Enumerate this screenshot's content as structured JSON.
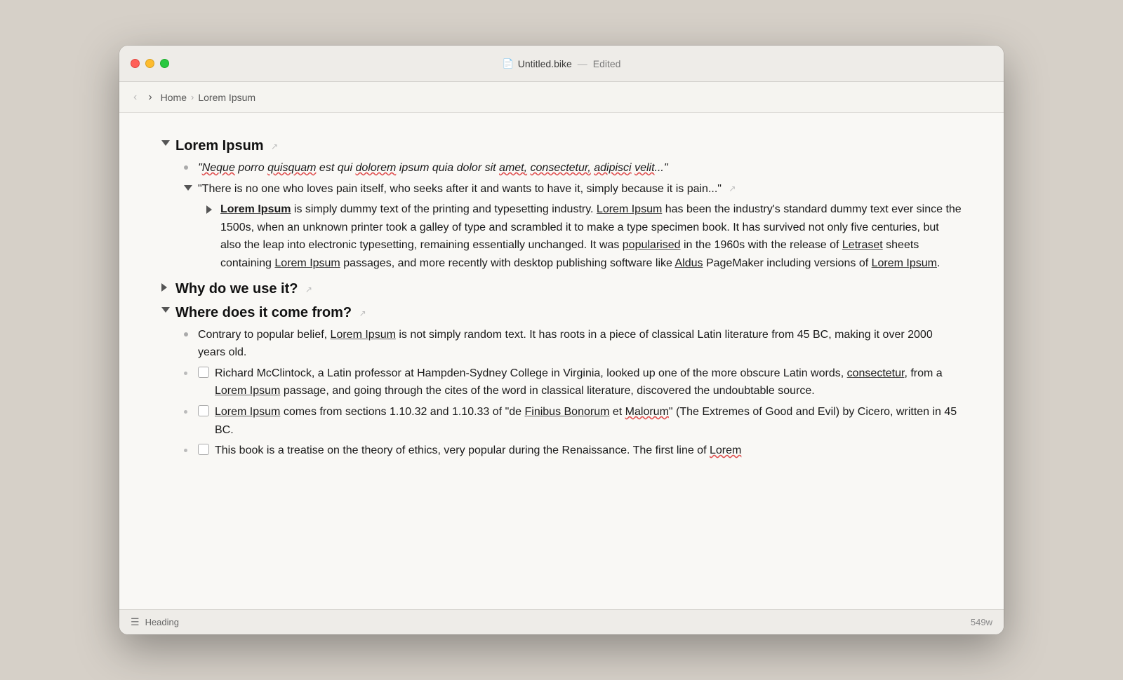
{
  "window": {
    "titlebar": {
      "icon": "📄",
      "filename": "Untitled.bike",
      "separator": "—",
      "edited": "Edited"
    },
    "toolbar": {
      "back_label": "‹",
      "forward_label": "›",
      "breadcrumb": [
        "Home",
        "Lorem Ipsum"
      ]
    },
    "statusbar": {
      "icon": "☰",
      "node_type": "Heading",
      "word_count": "549w"
    }
  },
  "content": {
    "rows": [
      {
        "id": "row-lorem-heading",
        "indent": 0,
        "triangle": "expanded",
        "text": "Lorem Ipsum",
        "style": "heading",
        "hover_arrow": true
      },
      {
        "id": "row-quote-latin",
        "indent": 1,
        "triangle": "bullet",
        "text": "\"Neque porro quisquam est qui dolorem ipsum quia dolor sit amet, consectetur, adipisci velit...\"",
        "style": "italic"
      },
      {
        "id": "row-quote-english",
        "indent": 1,
        "triangle": "expanded",
        "text": "\"There is no one who loves pain itself, who seeks after it and wants to have it, simply because it is pain...\"",
        "style": "normal",
        "hover_arrow": true
      },
      {
        "id": "row-lorem-body",
        "indent": 2,
        "triangle": "collapsed",
        "text": "Lorem Ipsum is simply dummy text of the printing and typesetting industry. Lorem Ipsum has been the industry's standard dummy text ever since the 1500s, when an unknown printer took a galley of type and scrambled it to make a type specimen book. It has survived not only five centuries, but also the leap into electronic typesetting, remaining essentially unchanged. It was popularised in the 1960s with the release of Letraset sheets containing Lorem Ipsum passages, and more recently with desktop publishing software like Aldus PageMaker including versions of Lorem Ipsum.",
        "style": "normal",
        "bold_start": "Lorem Ipsum"
      },
      {
        "id": "row-why-heading",
        "indent": 0,
        "triangle": "collapsed",
        "text": "Why do we use it?",
        "style": "heading",
        "hover_arrow": true
      },
      {
        "id": "row-where-heading",
        "indent": 0,
        "triangle": "expanded",
        "text": "Where does it come from?",
        "style": "heading",
        "hover_arrow": true
      },
      {
        "id": "row-contrary",
        "indent": 1,
        "triangle": "bullet",
        "text": "Contrary to popular belief, Lorem Ipsum is not simply random text. It has roots in a piece of classical Latin literature from 45 BC, making it over 2000 years old.",
        "style": "normal"
      },
      {
        "id": "row-richard",
        "indent": 1,
        "triangle": "bullet",
        "checkbox": true,
        "text": "Richard McClintock, a Latin professor at Hampden-Sydney College in Virginia, looked up one of the more obscure Latin words, consectetur, from a Lorem Ipsum passage, and going through the cites of the word in classical literature, discovered the undoubtable source.",
        "style": "normal"
      },
      {
        "id": "row-sections",
        "indent": 1,
        "triangle": "bullet",
        "checkbox": true,
        "text": "Lorem Ipsum comes from sections 1.10.32 and 1.10.33 of \"de Finibus Bonorum et Malorum\" (The Extremes of Good and Evil) by Cicero, written in 45 BC.",
        "style": "normal"
      },
      {
        "id": "row-treatise",
        "indent": 1,
        "triangle": "bullet",
        "checkbox": true,
        "text": "This book is a treatise on the theory of ethics, very popular during the Renaissance. The first line of Lorem",
        "style": "normal"
      }
    ]
  }
}
